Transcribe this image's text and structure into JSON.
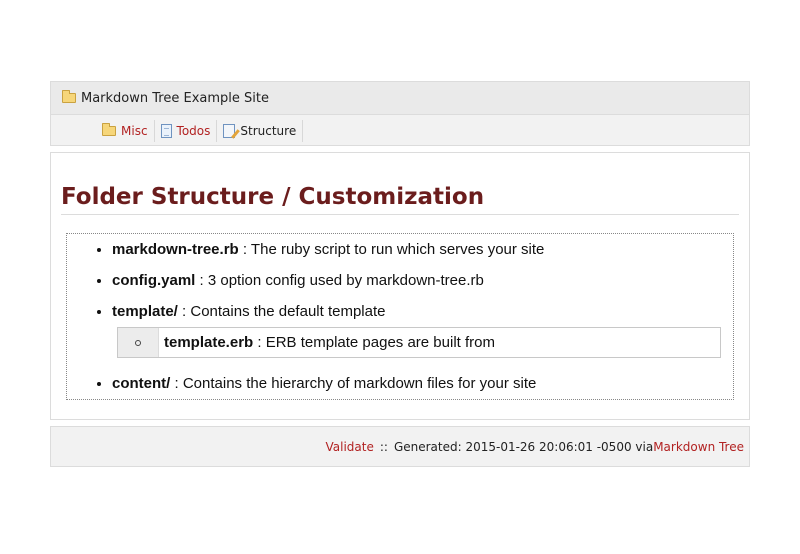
{
  "header": {
    "site_title": "Markdown Tree Example Site",
    "title_icon": "folder-icon"
  },
  "nav": {
    "items": [
      {
        "label": "Misc",
        "icon": "folder-icon",
        "link": true
      },
      {
        "label": "Todos",
        "icon": "document-icon",
        "link": true
      },
      {
        "label": "Structure",
        "icon": "edit-document-icon",
        "link": false
      }
    ]
  },
  "content": {
    "heading": "Folder Structure / Customization",
    "items": [
      {
        "term": "markdown-tree.rb",
        "desc": " : The ruby script to run which serves your site"
      },
      {
        "term": "config.yaml",
        "desc": " : 3 option config used by markdown-tree.rb"
      },
      {
        "term": "template/",
        "desc": " : Contains the default template"
      },
      {
        "term": "content/",
        "desc": " : Contains the hierarchy of markdown files for your site"
      }
    ],
    "subitem": {
      "term": "template.erb",
      "desc": " : ERB template pages are built from"
    }
  },
  "footer": {
    "validate_label": "Validate",
    "separator": "::",
    "generated_text": "Generated: 2015-01-26 20:06:01 -0500 via ",
    "app_link": "Markdown Tree"
  },
  "colors": {
    "link": "#b22222",
    "heading": "#6b1d1d"
  }
}
